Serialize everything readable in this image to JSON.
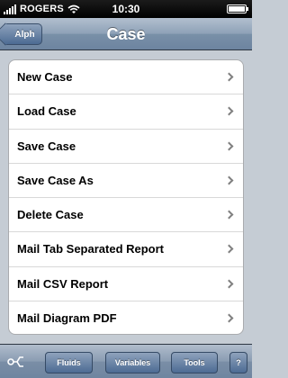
{
  "status": {
    "carrier": "ROGERS",
    "time": "10:30"
  },
  "nav": {
    "back_label": "Alph",
    "title": "Case"
  },
  "menu": {
    "items": [
      {
        "label": "New Case"
      },
      {
        "label": "Load Case"
      },
      {
        "label": "Save Case"
      },
      {
        "label": "Save Case As"
      },
      {
        "label": "Delete Case"
      },
      {
        "label": "Mail Tab Separated Report"
      },
      {
        "label": "Mail CSV Report"
      },
      {
        "label": "Mail Diagram PDF"
      }
    ]
  },
  "toolbar": {
    "fluids_label": "Fluids",
    "variables_label": "Variables",
    "tools_label": "Tools",
    "help_label": "?",
    "icon": "flow-diagram-icon"
  },
  "colors": {
    "nav_bar": "#8ea1b7",
    "background": "#c5ccd4",
    "button": "#4d6b93"
  }
}
